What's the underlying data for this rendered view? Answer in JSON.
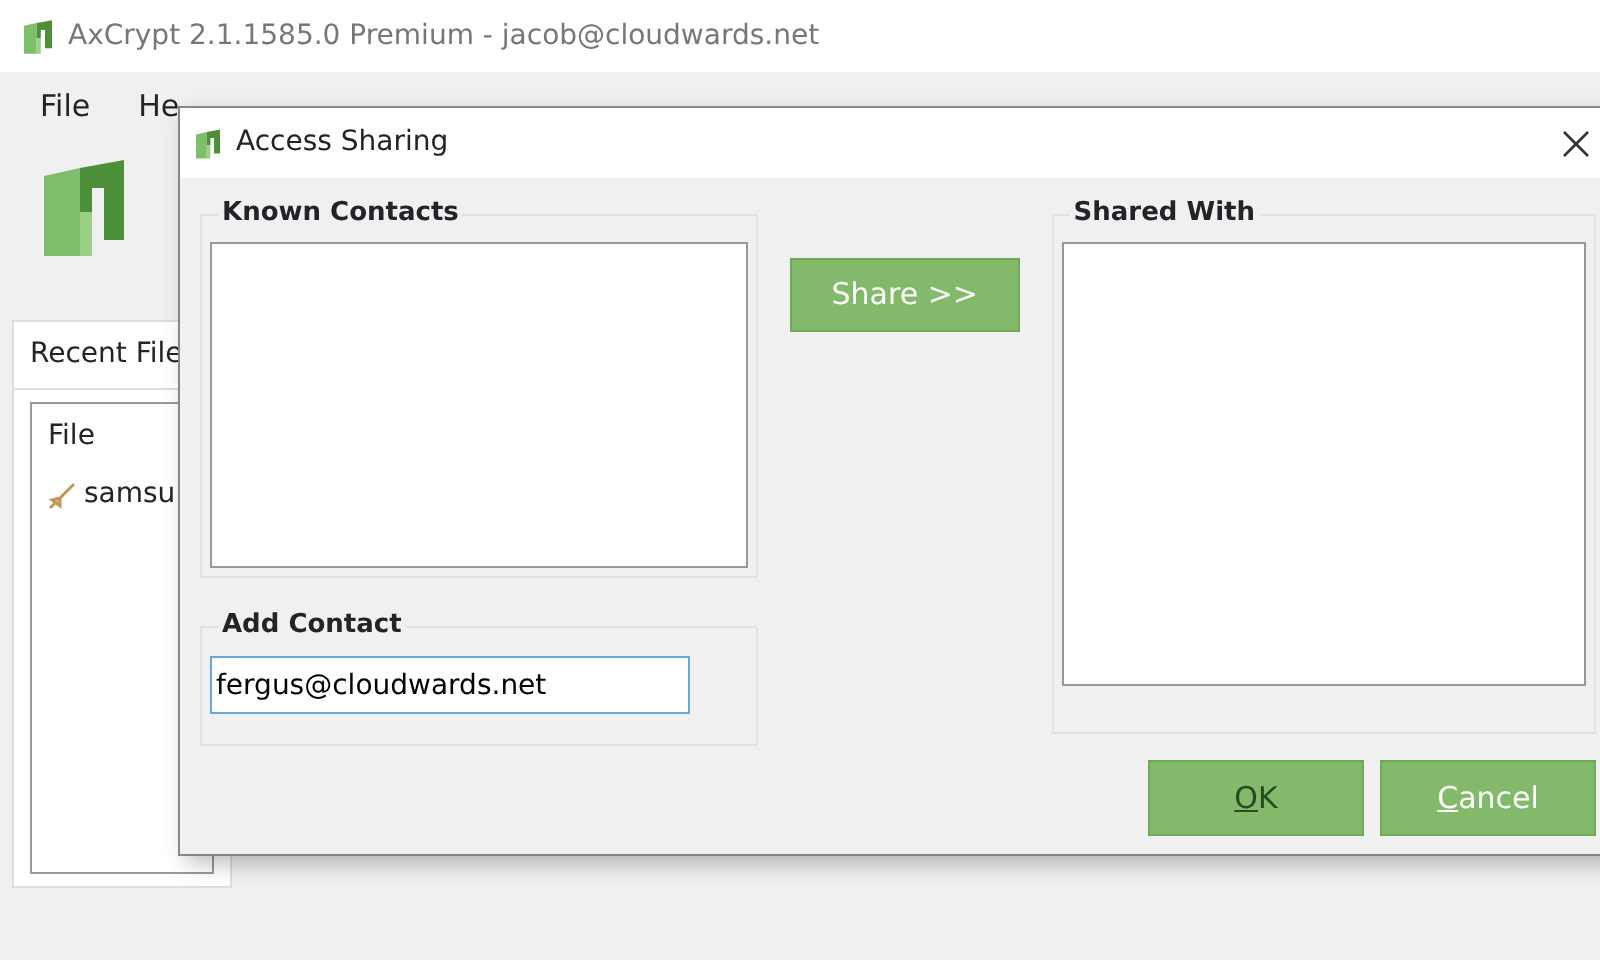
{
  "main_window": {
    "title": "AxCrypt 2.1.1585.0 Premium - jacob@cloudwards.net",
    "menu": [
      "File",
      "He"
    ],
    "recent_tab": "Recent File",
    "file_column": "File",
    "files": [
      {
        "name": "samsu"
      }
    ]
  },
  "dialog": {
    "title": "Access Sharing",
    "known_contacts": {
      "label": "Known Contacts"
    },
    "add_contact": {
      "label": "Add Contact",
      "value": "fergus@cloudwards.net"
    },
    "share_button": "Share >>",
    "shared_with": {
      "label": "Shared With"
    },
    "buttons": [
      {
        "label": "OK",
        "underline_first": true,
        "default": true
      },
      {
        "label": "Cancel",
        "underline_first": true,
        "default": false
      }
    ]
  }
}
